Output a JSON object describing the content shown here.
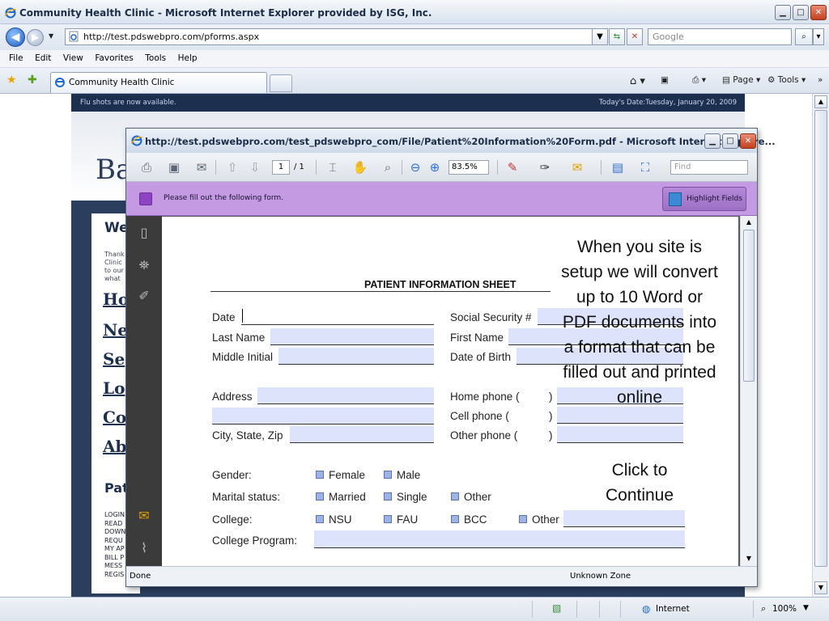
{
  "browser": {
    "title": "Community Health Clinic - Microsoft Internet Explorer provided by ISG, Inc.",
    "url": "http://test.pdswebpro.com/pforms.aspx",
    "search_placeholder": "Google",
    "menu": [
      "File",
      "Edit",
      "View",
      "Favorites",
      "Tools",
      "Help"
    ],
    "tab_label": "Community Health Clinic",
    "commands": {
      "page": "Page",
      "tools": "Tools"
    }
  },
  "site": {
    "top_notice": "Flu shots are now available.",
    "date_text": "Today's Date:Tuesday, January 20, 2009",
    "logo_partial": "Ba",
    "welcome_partial": "We",
    "thanks_lines": [
      "Thank",
      "Clinic",
      "to our",
      "what"
    ],
    "nav_partial": [
      "Ho",
      "Ne",
      "Se",
      "Lo",
      "Co",
      "Ab"
    ],
    "patient_partial": "Pat",
    "small_links": [
      "LOGIN",
      "READ",
      "DOWN",
      "REQU",
      "MY AP",
      "BILL P",
      "MESS",
      "REGIS"
    ]
  },
  "popup": {
    "title": "http://test.pdswebpro.com/test_pdswebpro_com/File/Patient%20Information%20Form.pdf - Microsoft Internet Explore...",
    "page_current": "1",
    "page_total": "/ 1",
    "zoom": "83.5%",
    "find_placeholder": "Find",
    "message": "Please fill out the following form.",
    "highlight_button": "Highlight Fields",
    "status_done": "Done",
    "status_zone": "Unknown Zone"
  },
  "form": {
    "title": "PATIENT INFORMATION SHEET",
    "labels": {
      "date": "Date",
      "last_name": "Last Name",
      "middle_initial": "Middle Initial",
      "ssn": "Social Security #",
      "first_name": "First Name",
      "dob": "Date of Birth",
      "address": "Address",
      "city_state_zip": "City, State, Zip",
      "home_phone": "Home phone (",
      "cell_phone": "Cell phone    (",
      "other_phone": "Other phone  (",
      "paren_close": ")",
      "gender": "Gender:",
      "marital": "Marital status:",
      "college": "College:",
      "college_program": "College Program:"
    },
    "options": {
      "gender": [
        "Female",
        "Male"
      ],
      "marital": [
        "Married",
        "Single",
        "Other"
      ],
      "college": [
        "NSU",
        "FAU",
        "BCC",
        "Other"
      ]
    },
    "callout": "When you site is setup we will convert up to 10 Word or PDF documents into a format that can be filled out and printed online",
    "click_continue": "Click to Continue"
  },
  "statusbar": {
    "zone": "Internet",
    "zoom": "100%"
  }
}
